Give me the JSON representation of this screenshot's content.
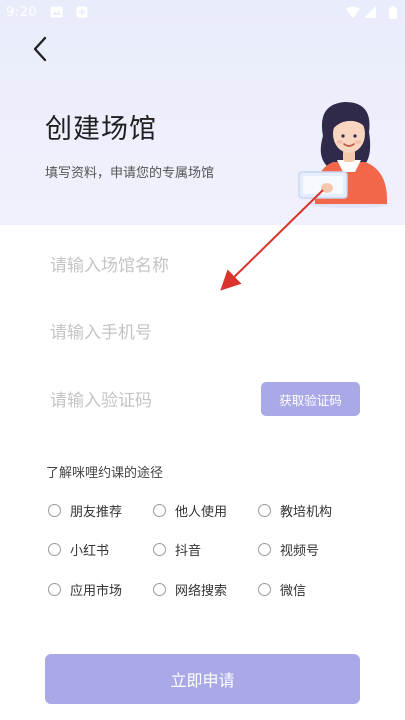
{
  "status_bar": {
    "time": "9:20"
  },
  "header": {
    "title": "创建场馆",
    "subtitle": "填写资料，申请您的专属场馆"
  },
  "form": {
    "venue_name_placeholder": "请输入场馆名称",
    "phone_placeholder": "请输入手机号",
    "code_placeholder": "请输入验证码",
    "get_code_label": "获取验证码"
  },
  "source": {
    "label": "了解咪哩约课的途径",
    "options": [
      "朋友推荐",
      "他人使用",
      "教培机构",
      "小红书",
      "抖音",
      "视频号",
      "应用市场",
      "网络搜索",
      "微信"
    ]
  },
  "submit_label": "立即申请",
  "colors": {
    "accent": "#a9a9e8",
    "hero_bg": "#e9ecfb",
    "arrow": "#d9332b"
  },
  "icons": [
    "back-arrow-icon",
    "image-icon",
    "notification-icon",
    "wifi-icon",
    "signal-icon",
    "battery-icon"
  ]
}
